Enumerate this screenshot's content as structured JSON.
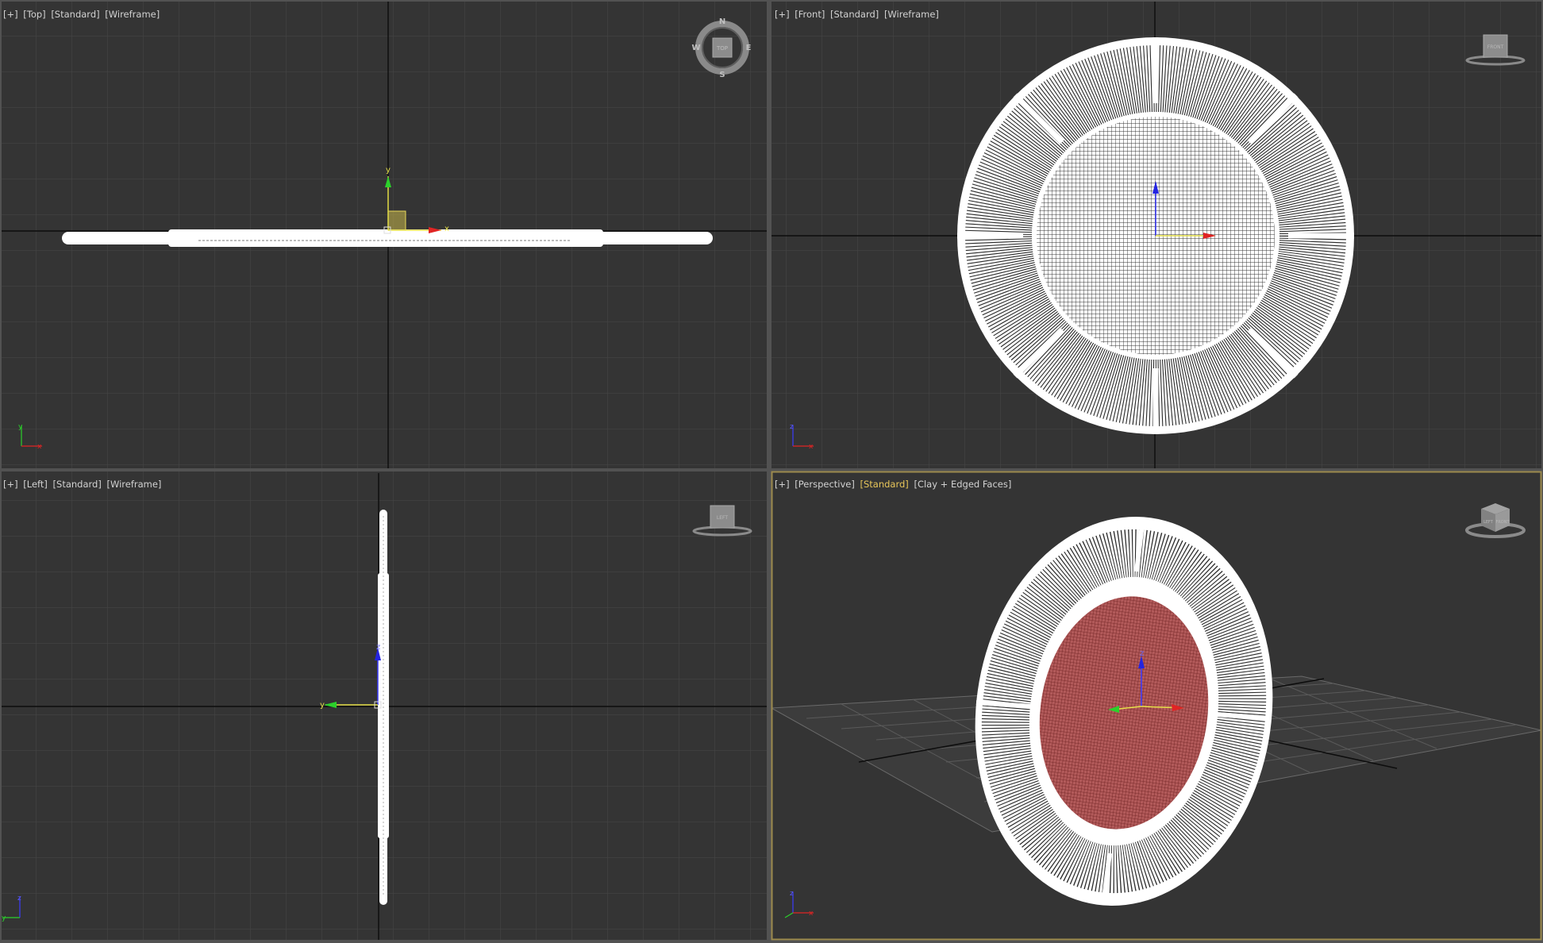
{
  "viewports": {
    "top": {
      "plus": "[+]",
      "view": "[Top]",
      "mode": "[Standard]",
      "shading": "[Wireframe]",
      "compass": {
        "n": "N",
        "s": "S",
        "e": "E",
        "w": "W",
        "cube": "TOP"
      },
      "gizmo": {
        "x": "x",
        "y": "y"
      },
      "axis_tripod": {
        "a": "y",
        "b": "x"
      }
    },
    "front": {
      "plus": "[+]",
      "view": "[Front]",
      "mode": "[Standard]",
      "shading": "[Wireframe]",
      "cube": "FRONT",
      "axis_tripod": {
        "a": "z",
        "b": "x"
      }
    },
    "left": {
      "plus": "[+]",
      "view": "[Left]",
      "mode": "[Standard]",
      "shading": "[Wireframe]",
      "cube": "LEFT",
      "gizmo": {
        "z": "z",
        "y": "y"
      },
      "axis_tripod": {
        "a": "z",
        "b": "y"
      }
    },
    "persp": {
      "plus": "[+]",
      "view": "[Perspective]",
      "mode": "[Standard]",
      "shading": "[Clay + Edged Faces]",
      "cube_l": "LEFT",
      "cube_r": "FRONT",
      "gizmo": {
        "z": "z"
      },
      "axis_tripod": {
        "a": "z",
        "b": "x"
      }
    }
  },
  "colors": {
    "viewport_bg": "#343434",
    "grid": "#474747",
    "axis": "#0d0d0d",
    "label": "#d2d2d2",
    "active_label": "#e8c65a",
    "active_border": "#9c8a4d",
    "divider": "#525252",
    "object": "#ffffff",
    "sphere_fill": "#a84a4a"
  }
}
